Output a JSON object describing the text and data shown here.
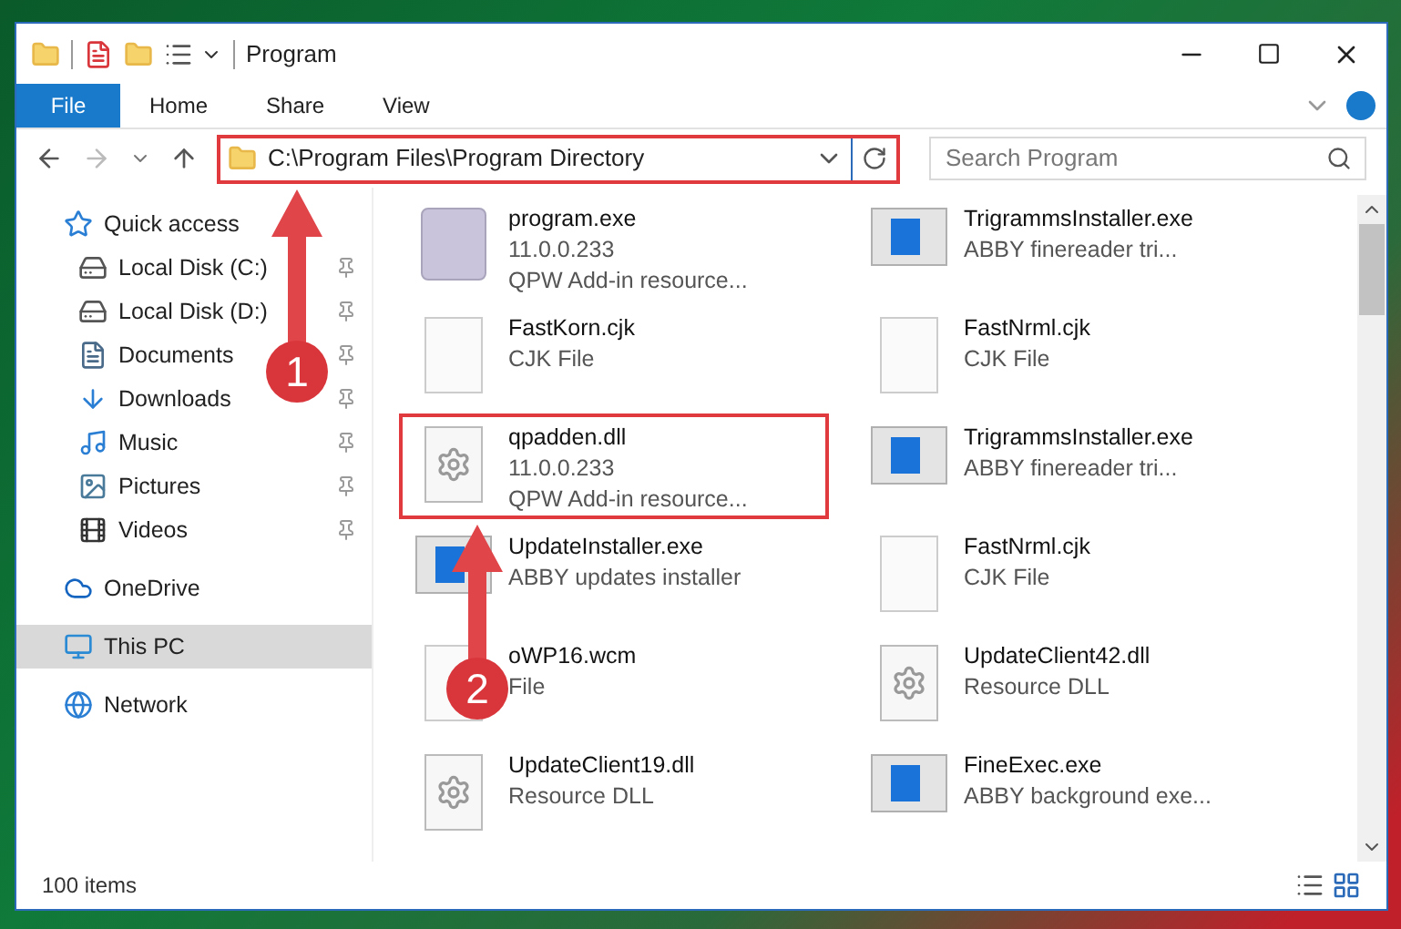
{
  "window": {
    "title": "Program"
  },
  "ribbon_tabs": [
    {
      "label": "File",
      "selected": true
    },
    {
      "label": "Home",
      "selected": false
    },
    {
      "label": "Share",
      "selected": false
    },
    {
      "label": "View",
      "selected": false
    }
  ],
  "address": {
    "value": "C:\\Program Files\\Program Directory"
  },
  "search": {
    "placeholder": "Search Program"
  },
  "sidebar": {
    "items": [
      {
        "label": "Quick access",
        "kind": "star",
        "selected": false,
        "children": [
          {
            "label": "Local Disk (C:)",
            "kind": "disk-c",
            "pinned": true,
            "selected": false
          },
          {
            "label": "Local Disk (D:)",
            "kind": "disk",
            "pinned": true,
            "selected": false
          },
          {
            "label": "Documents",
            "kind": "doc",
            "pinned": true,
            "selected": false
          },
          {
            "label": "Downloads",
            "kind": "download",
            "pinned": true,
            "selected": false
          },
          {
            "label": "Music",
            "kind": "music",
            "pinned": true,
            "selected": false
          },
          {
            "label": "Pictures",
            "kind": "picture",
            "pinned": true,
            "selected": false
          },
          {
            "label": "Videos",
            "kind": "video",
            "pinned": true,
            "selected": false
          }
        ]
      },
      {
        "label": "OneDrive",
        "kind": "cloud",
        "selected": false
      },
      {
        "label": "This PC",
        "kind": "pc",
        "selected": true
      },
      {
        "label": "Network",
        "kind": "network",
        "selected": false
      }
    ]
  },
  "files": {
    "columns": [
      [
        {
          "name": "program.exe",
          "lines": [
            "11.0.0.233",
            "QPW Add-in resource..."
          ],
          "kind": "app",
          "highlighted": false
        },
        {
          "name": "FastKorn.cjk",
          "lines": [
            "CJK File"
          ],
          "kind": "blank",
          "highlighted": false
        },
        {
          "name": "qpadden.dll",
          "lines": [
            "11.0.0.233",
            "QPW Add-in resource..."
          ],
          "kind": "gear",
          "highlighted": true
        },
        {
          "name": "UpdateInstaller.exe",
          "lines": [
            "ABBY updates installer"
          ],
          "kind": "window",
          "highlighted": false
        },
        {
          "name": "oWP16.wcm",
          "lines": [
            "File"
          ],
          "kind": "blank",
          "highlighted": false
        },
        {
          "name": "UpdateClient19.dll",
          "lines": [
            "Resource DLL"
          ],
          "kind": "gear",
          "highlighted": false
        }
      ],
      [
        {
          "name": "TrigrammsInstaller.exe",
          "lines": [
            "ABBY finereader tri..."
          ],
          "kind": "window",
          "highlighted": false
        },
        {
          "name": "FastNrml.cjk",
          "lines": [
            "CJK File"
          ],
          "kind": "blank",
          "highlighted": false
        },
        {
          "name": "TrigrammsInstaller.exe",
          "lines": [
            "ABBY finereader tri..."
          ],
          "kind": "window",
          "highlighted": false
        },
        {
          "name": "FastNrml.cjk",
          "lines": [
            "CJK File"
          ],
          "kind": "blank",
          "highlighted": false
        },
        {
          "name": "UpdateClient42.dll",
          "lines": [
            "Resource DLL"
          ],
          "kind": "gear",
          "highlighted": false
        },
        {
          "name": "FineExec.exe",
          "lines": [
            "ABBY background exe..."
          ],
          "kind": "window",
          "highlighted": false
        }
      ]
    ]
  },
  "status_bar": {
    "count": "100 items"
  },
  "annotations": [
    {
      "number": "1"
    },
    {
      "number": "2"
    }
  ]
}
